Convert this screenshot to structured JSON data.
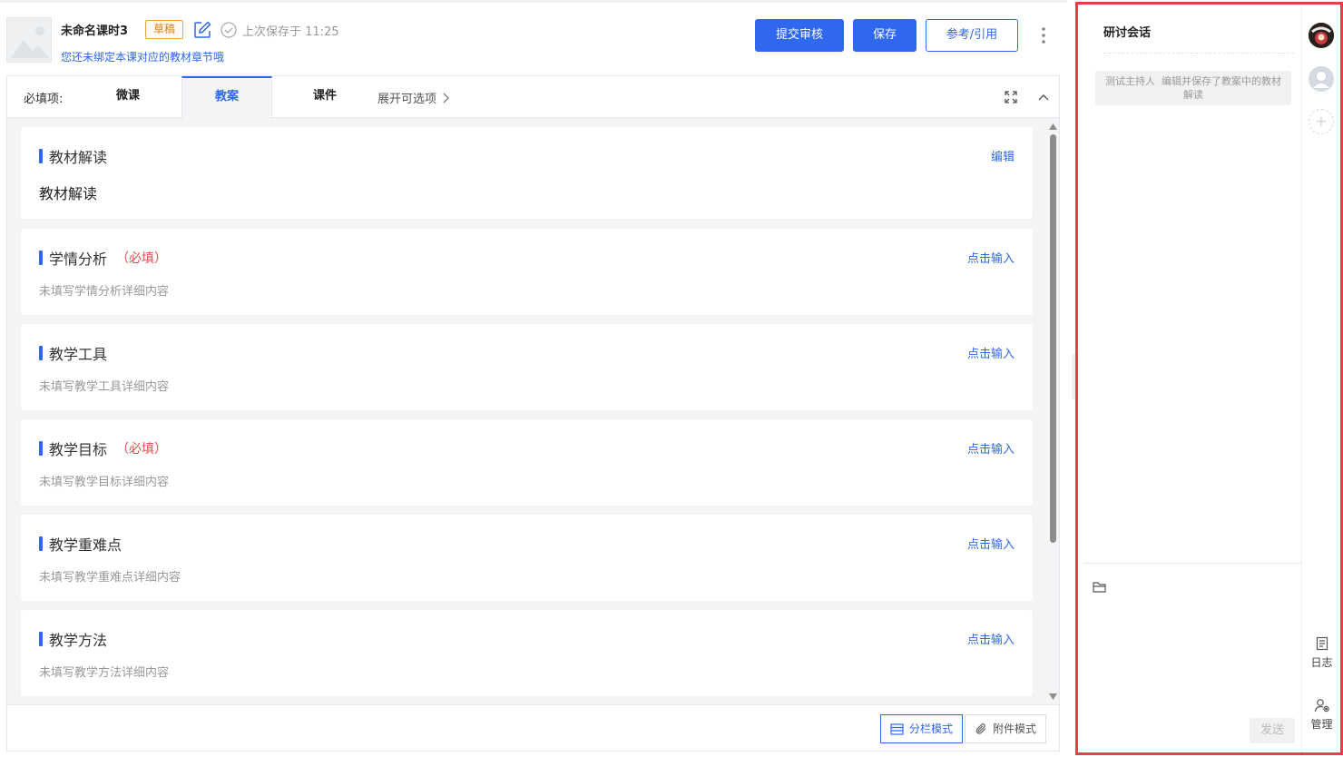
{
  "header": {
    "title": "未命名课时3",
    "badge": "草稿",
    "saved_text": "上次保存于 11:25",
    "bind_hint": "您还未绑定本课对应的教材章节哦",
    "submit_label": "提交审核",
    "save_label": "保存",
    "reference_label": "参考/引用"
  },
  "tabs": {
    "required_label": "必填项:",
    "items": [
      {
        "label": "微课"
      },
      {
        "label": "教案"
      },
      {
        "label": "课件"
      }
    ],
    "expand_label": "展开可选项"
  },
  "sections": [
    {
      "title": "教材解读",
      "required": "",
      "action": "编辑",
      "body": "教材解读"
    },
    {
      "title": "学情分析",
      "required": "（必填）",
      "action": "点击输入",
      "body": "未填写学情分析详细内容"
    },
    {
      "title": "教学工具",
      "required": "",
      "action": "点击输入",
      "body": "未填写教学工具详细内容"
    },
    {
      "title": "教学目标",
      "required": "（必填）",
      "action": "点击输入",
      "body": "未填写教学目标详细内容"
    },
    {
      "title": "教学重难点",
      "required": "",
      "action": "点击输入",
      "body": "未填写教学重难点详细内容"
    },
    {
      "title": "教学方法",
      "required": "",
      "action": "点击输入",
      "body": "未填写教学方法详细内容"
    }
  ],
  "footer": {
    "split_mode": "分栏模式",
    "attach_mode": "附件模式"
  },
  "chat": {
    "title": "研讨会话",
    "message_sender": "测试主持人",
    "message_text": "编辑并保存了教案中的教材解读",
    "send_label": "发送",
    "log_label": "日志",
    "manage_label": "管理",
    "add_symbol": "+"
  },
  "colors": {
    "accent": "#2f68ee",
    "required": "#e04b4b",
    "draft": "#d88318",
    "highlight_border": "#e83f46"
  }
}
